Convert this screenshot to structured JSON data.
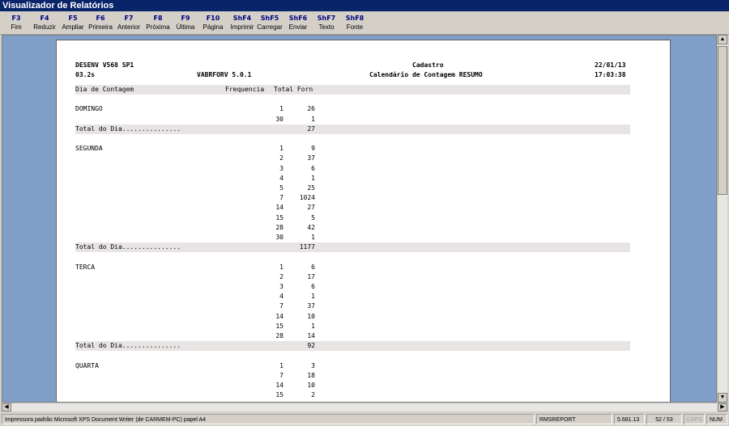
{
  "window": {
    "title": "Visualizador de Relatórios"
  },
  "toolbar": [
    {
      "key": "F3",
      "label": "Fim"
    },
    {
      "key": "F4",
      "label": "Reduzir"
    },
    {
      "key": "F5",
      "label": "Ampliar"
    },
    {
      "key": "F6",
      "label": "Primeira"
    },
    {
      "key": "F7",
      "label": "Anterior"
    },
    {
      "key": "F8",
      "label": "Próxima"
    },
    {
      "key": "F9",
      "label": "Última"
    },
    {
      "key": "F10",
      "label": "Página"
    },
    {
      "key": "ShF4",
      "label": "Imprimir"
    },
    {
      "key": "ShF5",
      "label": "Carregar"
    },
    {
      "key": "ShF6",
      "label": "Enviar"
    },
    {
      "key": "ShF7",
      "label": "Texto"
    },
    {
      "key": "ShF8",
      "label": "Fonte"
    }
  ],
  "report": {
    "system": "DESENV V568 SP1",
    "version_code": "03.2s",
    "program": "VABRFORV 5.0.1",
    "title": "Cadastro",
    "subtitle": "Calendário de Contagem RESUMO",
    "date": "22/01/13",
    "time": "17:03:38",
    "columns": {
      "day": "Dia de Contagem",
      "freq": "Frequencia",
      "total": "Total Forn"
    },
    "total_label": "Total do Dia...............",
    "groups": [
      {
        "day": "DOMINGO",
        "rows": [
          [
            "1",
            "26"
          ],
          [
            "30",
            "1"
          ]
        ],
        "total": "27"
      },
      {
        "day": "SEGUNDA",
        "rows": [
          [
            "1",
            "9"
          ],
          [
            "2",
            "37"
          ],
          [
            "3",
            "6"
          ],
          [
            "4",
            "1"
          ],
          [
            "5",
            "25"
          ],
          [
            "7",
            "1024"
          ],
          [
            "14",
            "27"
          ],
          [
            "15",
            "5"
          ],
          [
            "28",
            "42"
          ],
          [
            "30",
            "1"
          ]
        ],
        "total": "1177"
      },
      {
        "day": "TERCA",
        "rows": [
          [
            "1",
            "6"
          ],
          [
            "2",
            "17"
          ],
          [
            "3",
            "6"
          ],
          [
            "4",
            "1"
          ],
          [
            "7",
            "37"
          ],
          [
            "14",
            "10"
          ],
          [
            "15",
            "1"
          ],
          [
            "28",
            "14"
          ]
        ],
        "total": "92"
      },
      {
        "day": "QUARTA",
        "rows": [
          [
            "1",
            "3"
          ],
          [
            "7",
            "18"
          ],
          [
            "14",
            "10"
          ],
          [
            "15",
            "2"
          ]
        ],
        "total": null
      }
    ]
  },
  "status": {
    "printer": "Impressora padrão Microsoft XPS Document Writer (de CARMEM-PC) papel A4",
    "module": "RMSREPORT",
    "build": "5.681.13",
    "page": "52 / 53",
    "caps": "CAPS",
    "num": "NUM"
  }
}
